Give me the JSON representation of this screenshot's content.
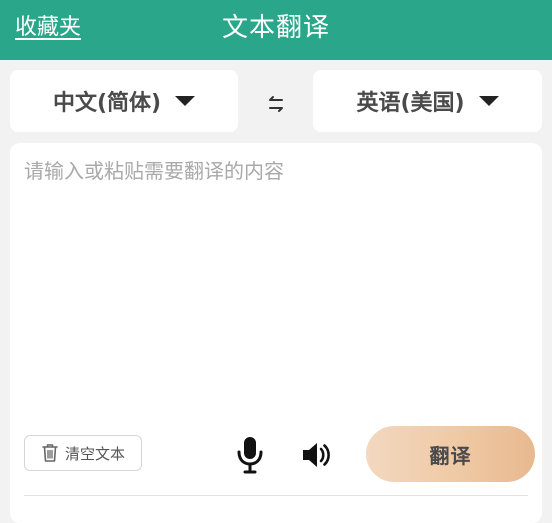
{
  "header": {
    "favorites_label": "收藏夹",
    "title": "文本翻译",
    "background_color": "#2aa68b"
  },
  "languages": {
    "source": "中文(简体)",
    "target": "英语(美国)",
    "swap_icon": "swap-arrows-icon"
  },
  "input": {
    "placeholder": "请输入或粘贴需要翻译的内容",
    "value": ""
  },
  "actions": {
    "clear_label": "清空文本",
    "clear_icon": "trash-icon",
    "mic_icon": "microphone-icon",
    "speaker_icon": "speaker-icon",
    "translate_label": "翻译"
  }
}
